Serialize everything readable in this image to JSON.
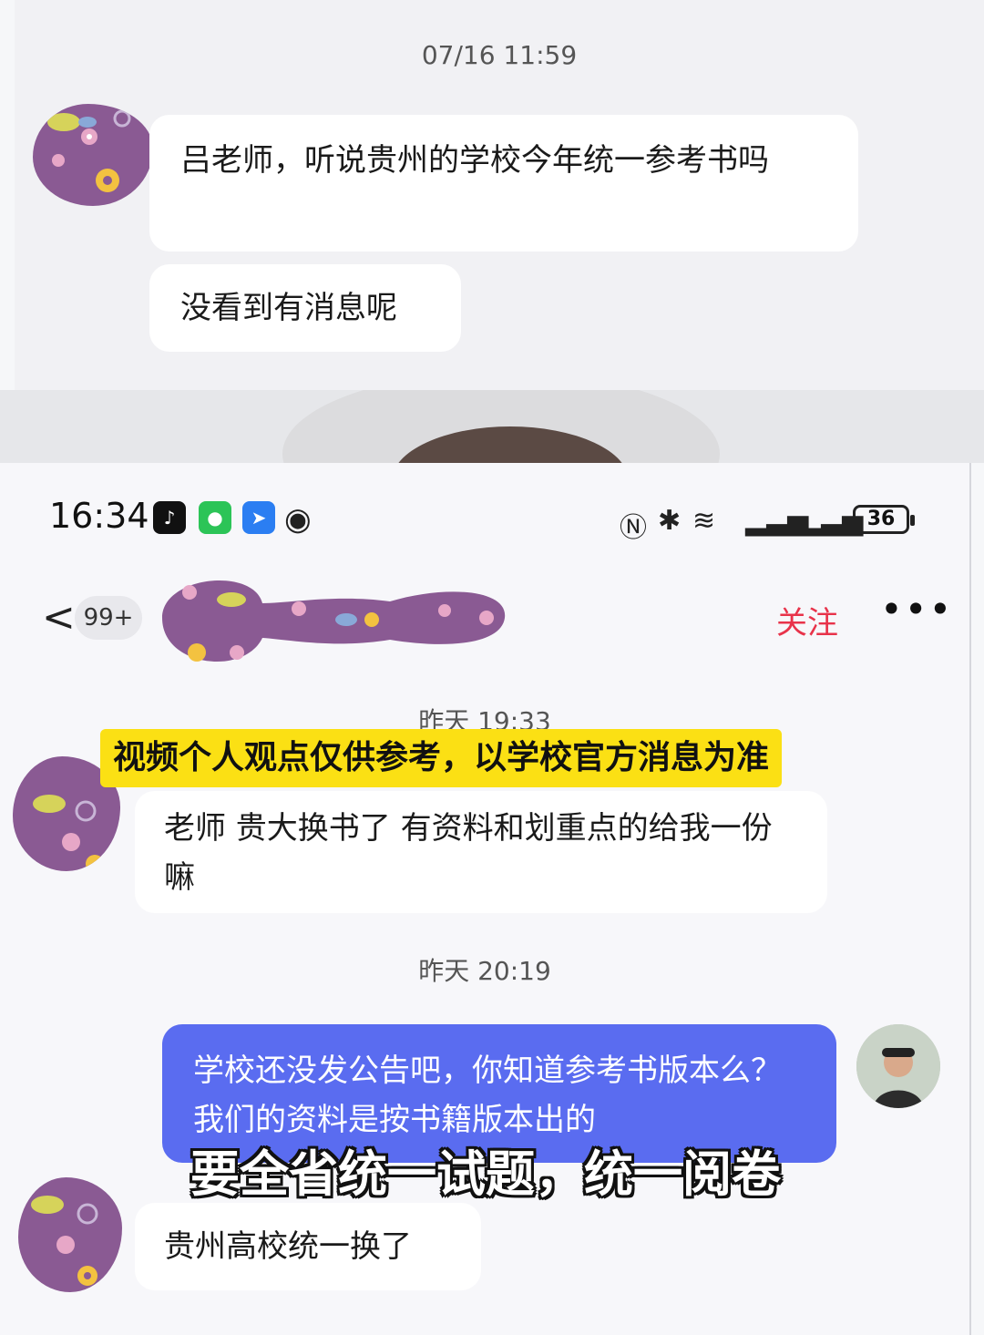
{
  "top_chat": {
    "timestamp": "07/16 11:59",
    "messages": [
      {
        "text": "吕老师，听说贵州的学校今年统一参考书吗"
      },
      {
        "text": "没看到有消息呢"
      }
    ]
  },
  "status_bar": {
    "time": "16:34",
    "battery": "36"
  },
  "nav": {
    "back_icon": "chevron-left-icon",
    "unread_badge": "99+",
    "follow_label": "关注",
    "more_label": "•••"
  },
  "chat": {
    "timestamp_1": "昨天 19:33",
    "timestamp_2": "昨天 20:19",
    "messages": [
      {
        "side": "left",
        "text": "老师 贵大换书了 有资料和划重点的给我一份嘛"
      },
      {
        "side": "right",
        "text": "学校还没发公告吧，你知道参考书版本么？我们的资料是按书籍版本出的"
      },
      {
        "side": "left",
        "text": "贵州高校统一换了"
      }
    ]
  },
  "overlays": {
    "caption": "视频个人观点仅供参考，以学校官方消息为准",
    "subtitle": "要全省统一试题，统一阅卷"
  },
  "colors": {
    "follow": "#e8334a",
    "my_bubble": "#5a6cf0",
    "caption_bg": "#fbe014",
    "avatar_purple": "#8a5a93"
  }
}
